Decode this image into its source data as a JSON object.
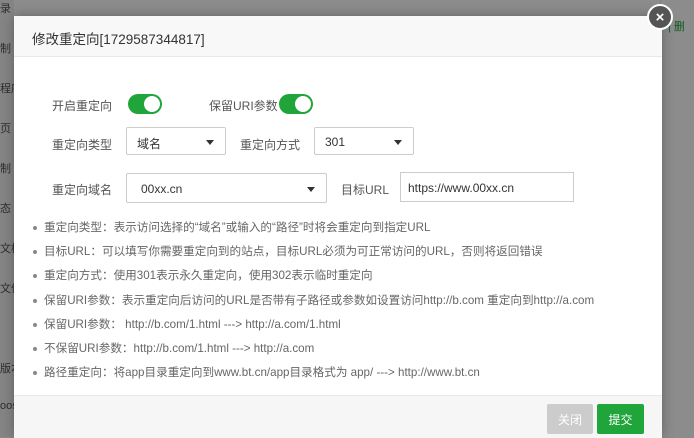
{
  "background": {
    "sidebar_items": [
      "录",
      "制",
      "程序",
      "页",
      "制",
      "态",
      "文档",
      "文件",
      "版本",
      "oos"
    ],
    "right_text": "| 删"
  },
  "dialog": {
    "title": "修改重定向[1729587344817]",
    "close_label": "×",
    "enable_redirect_label": "开启重定向",
    "keep_uri_label": "保留URI参数",
    "enable_redirect_on": true,
    "keep_uri_on": true,
    "redirect_type_label": "重定向类型",
    "redirect_type_value": "域名",
    "redirect_method_label": "重定向方式",
    "redirect_method_value": "301",
    "redirect_domain_label": "重定向域名",
    "redirect_domain_value": "00xx.cn",
    "target_url_label": "目标URL",
    "target_url_value": "https://www.00xx.cn",
    "tips": [
      "重定向类型：表示访问选择的“域名”或输入的“路径”时将会重定向到指定URL",
      "目标URL：可以填写你需要重定向到的站点，目标URL必须为可正常访问的URL，否则将返回错误",
      "重定向方式：使用301表示永久重定向，使用302表示临时重定向",
      "保留URI参数：表示重定向后访问的URL是否带有子路径或参数如设置访问http://b.com 重定向到http://a.com",
      "保留URI参数：  http://b.com/1.html ---> http://a.com/1.html",
      "不保留URI参数：http://b.com/1.html ---> http://a.com",
      "路径重定向：将app目录重定向到www.bt.cn/app目录格式为 app/ ---> http://www.bt.cn"
    ],
    "close_button_label": "关闭",
    "submit_button_label": "提交"
  },
  "colors": {
    "accent": "#20a53a",
    "disabled_button": "#cccccc"
  }
}
